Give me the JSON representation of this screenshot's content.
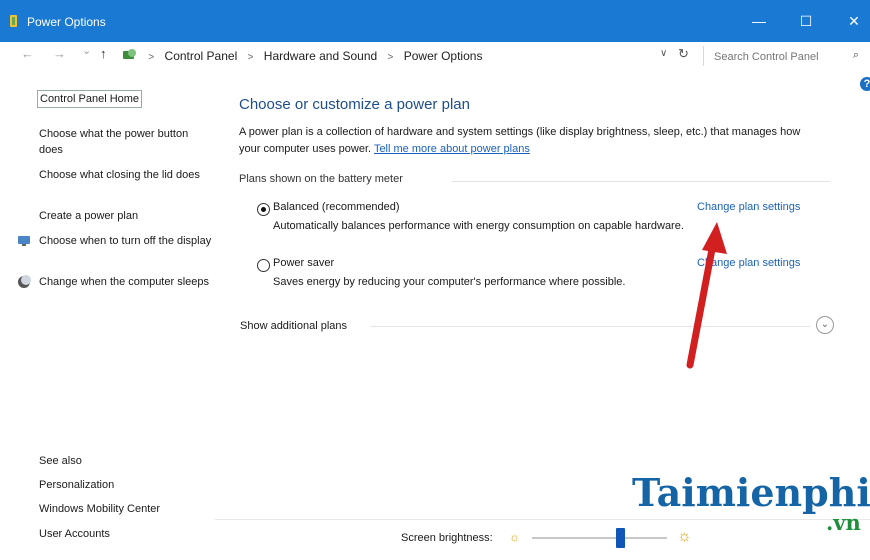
{
  "window": {
    "title": "Power Options",
    "minimize_glyph": "—",
    "maximize_glyph": "☐",
    "close_glyph": "✕"
  },
  "address": {
    "back_glyph": "←",
    "forward_glyph": "→",
    "recent_glyph": "⌄",
    "up_glyph": "↑",
    "crumbs": [
      "Control Panel",
      "Hardware and Sound",
      "Power Options"
    ],
    "dropdown_glyph": "∨",
    "refresh_glyph": "↻",
    "search_placeholder": "Search Control Panel",
    "search_glyph": "⌕"
  },
  "help_glyph": "?",
  "sidebar": {
    "home": "Control Panel Home",
    "links": [
      "Choose what the power button does",
      "Choose what closing the lid does",
      "Create a power plan",
      "Choose when to turn off the display",
      "Change when the computer sleeps"
    ],
    "see_also_label": "See also",
    "see_also": [
      "Personalization",
      "Windows Mobility Center",
      "User Accounts"
    ]
  },
  "main": {
    "heading": "Choose or customize a power plan",
    "intro": "A power plan is a collection of hardware and system settings (like display brightness, sleep, etc.) that manages how your computer uses power.",
    "intro_link": "Tell me more about power plans",
    "plans_label": "Plans shown on the battery meter",
    "plans": [
      {
        "name": "Balanced (recommended)",
        "selected": true,
        "description": "Automatically balances performance with energy consumption on capable hardware.",
        "change": "Change plan settings"
      },
      {
        "name": "Power saver",
        "selected": false,
        "description": "Saves energy by reducing your computer's performance where possible.",
        "change": "Change plan settings"
      }
    ],
    "additional_plans": "Show additional plans",
    "expand_glyph": "⌄"
  },
  "footer": {
    "brightness_label": "Screen brightness:",
    "brightness_level": 0.65,
    "sun_glyph": "☼"
  },
  "watermark": {
    "brand": "Taimienphi",
    "suffix": ".vn"
  },
  "colors": {
    "titlebar": "#1979d3",
    "link": "#1a62bd",
    "heading": "#1e4e8c",
    "arrow": "#d21f1f",
    "slider_thumb": "#0f56b6"
  }
}
